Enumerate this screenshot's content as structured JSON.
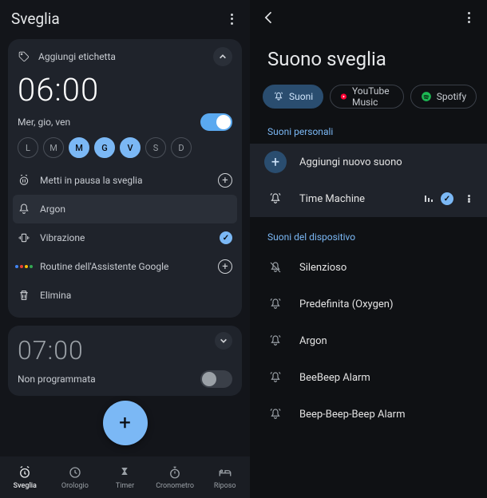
{
  "left": {
    "header": {
      "title": "Sveglia"
    },
    "alarm1": {
      "add_label": "Aggiungi etichetta",
      "time": "06:00",
      "schedule": "Mer, gio, ven",
      "enabled": true,
      "days": [
        {
          "label": "L",
          "on": false
        },
        {
          "label": "M",
          "on": false
        },
        {
          "label": "M",
          "on": true
        },
        {
          "label": "G",
          "on": true
        },
        {
          "label": "V",
          "on": true
        },
        {
          "label": "S",
          "on": false
        },
        {
          "label": "D",
          "on": false
        }
      ],
      "pause": "Metti in pausa la sveglia",
      "sound": "Argon",
      "vibration": "Vibrazione",
      "routine": "Routine dell'Assistente Google",
      "delete": "Elimina"
    },
    "alarm2": {
      "time": "07:00",
      "status": "Non programmata",
      "enabled": false
    },
    "nav": {
      "alarm": "Sveglia",
      "clock": "Orologio",
      "timer": "Timer",
      "stopwatch": "Cronometro",
      "bedtime": "Riposo"
    }
  },
  "right": {
    "title": "Suono sveglia",
    "chips": {
      "sounds": "Suoni",
      "youtube": "YouTube Music",
      "spotify": "Spotify"
    },
    "personal_head": "Suoni personali",
    "add_new": "Aggiungi nuovo suono",
    "personal_item": "Time Machine",
    "device_head": "Suoni del dispositivo",
    "device": {
      "silent": "Silenzioso",
      "default": "Predefinita (Oxygen)",
      "argon": "Argon",
      "beebeep": "BeeBeep Alarm",
      "beepbeep": "Beep-Beep-Beep Alarm"
    }
  }
}
